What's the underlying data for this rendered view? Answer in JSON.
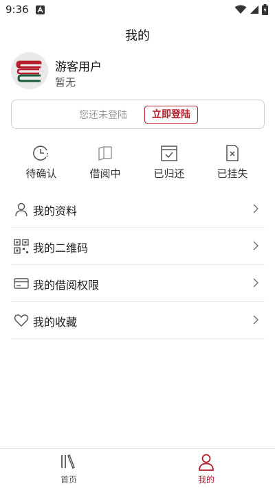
{
  "status_bar": {
    "time": "9:36"
  },
  "header": {
    "title": "我的"
  },
  "user": {
    "name": "游客用户",
    "subtitle": "暂无"
  },
  "login": {
    "prompt": "您还未登陆",
    "button_label": "立即登陆"
  },
  "borrow_status": [
    {
      "label": "待确认",
      "icon": "clock-pending-icon"
    },
    {
      "label": "借阅中",
      "icon": "book-open-icon"
    },
    {
      "label": "已归还",
      "icon": "calendar-check-icon"
    },
    {
      "label": "已挂失",
      "icon": "document-x-icon"
    }
  ],
  "menu": [
    {
      "label": "我的资料",
      "icon": "person-icon"
    },
    {
      "label": "我的二维码",
      "icon": "qr-code-icon"
    },
    {
      "label": "我的借阅权限",
      "icon": "card-icon"
    },
    {
      "label": "我的收藏",
      "icon": "heart-icon"
    }
  ],
  "tabs": [
    {
      "label": "首页",
      "icon": "library-icon",
      "active": false
    },
    {
      "label": "我的",
      "icon": "person-icon",
      "active": true
    }
  ],
  "colors": {
    "accent": "#b71c2b",
    "avatar_book_green": "#1b5e3b",
    "avatar_book_red": "#b71c2b"
  }
}
